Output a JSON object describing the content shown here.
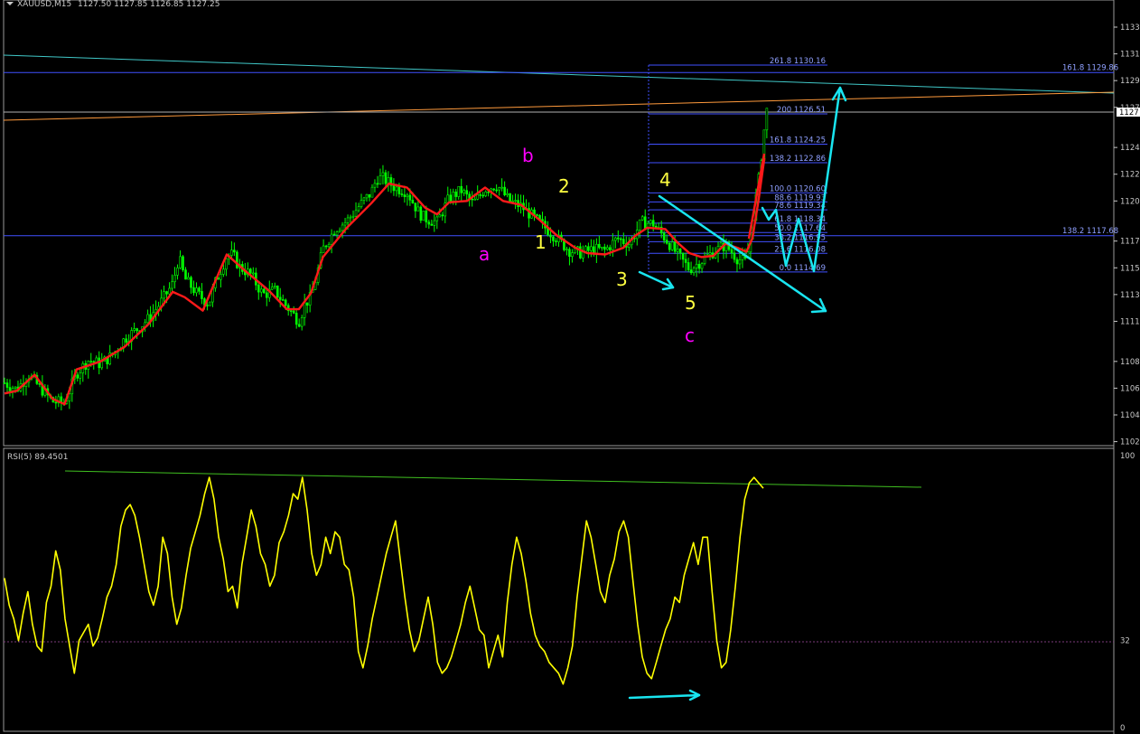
{
  "header": {
    "symbol": "XAUUSD,M15",
    "ohlc": "1127.50 1127.85 1126.85 1127.25",
    "rsi_label": "RSI(5) 89.4501"
  },
  "price_axis": {
    "ticks": [
      "1133",
      "1131",
      "1129",
      "1127",
      "1124",
      "1122",
      "1120",
      "1117",
      "1115",
      "1113",
      "1111",
      "1108",
      "1106",
      "1104",
      "1102"
    ],
    "current_price": "1127"
  },
  "rsi_axis": {
    "ticks": [
      "100",
      "32",
      "0"
    ]
  },
  "fib_levels": [
    {
      "label": "261.8 1130.16",
      "price": 1130.16
    },
    {
      "label": "200 1126.51",
      "price": 1126.51
    },
    {
      "label": "161.8 1124.25",
      "price": 1124.25
    },
    {
      "label": "138.2 1122.86",
      "price": 1122.86
    },
    {
      "label": "100.0 1120.60",
      "price": 1120.6
    },
    {
      "label": "88.6 1119.93",
      "price": 1119.93
    },
    {
      "label": "78.6 1119.34",
      "price": 1119.34
    },
    {
      "label": "61.8 1118.34",
      "price": 1118.34
    },
    {
      "label": "50.0 1117.64",
      "price": 1117.64
    },
    {
      "label": "38.2 1116.95",
      "price": 1116.95
    },
    {
      "label": "23.6 1116.08",
      "price": 1116.08
    },
    {
      "label": "0.0 1114.69",
      "price": 1114.69
    }
  ],
  "long_fib_levels": [
    {
      "label": "161.8 1129.86",
      "price": 1129.6
    },
    {
      "label": "138.2 1117.68",
      "price": 1117.4
    }
  ],
  "wave_labels": [
    {
      "text": "b",
      "color": "#ff00ff"
    },
    {
      "text": "a",
      "color": "#ff00ff"
    },
    {
      "text": "c",
      "color": "#ff00ff"
    },
    {
      "text": "2",
      "color": "#ffff40"
    },
    {
      "text": "1",
      "color": "#ffff40"
    },
    {
      "text": "3",
      "color": "#ffff40"
    },
    {
      "text": "4",
      "color": "#ffff40"
    },
    {
      "text": "5",
      "color": "#ffff40"
    }
  ],
  "colors": {
    "candle": "#00ff00",
    "moving_average": "#ff1a1a",
    "rsi_line": "#ffff00",
    "arrows": "#19e5f0",
    "fib_lines": "#4050ff",
    "trendline_upper": "#40c8c8",
    "trendline_orange": "#ff9a3c",
    "rsi_trendline": "#40c020"
  },
  "chart_data": [
    {
      "type": "line",
      "title": "XAUUSD,M15",
      "ylim": [
        1101.8,
        1135
      ],
      "grid": false,
      "ma_path": [
        [
          0.0,
          1105.6
        ],
        [
          0.02,
          1105.8
        ],
        [
          0.05,
          1107.0
        ],
        [
          0.08,
          1105.2
        ],
        [
          0.1,
          1104.8
        ],
        [
          0.12,
          1107.4
        ],
        [
          0.16,
          1108.0
        ],
        [
          0.2,
          1109.1
        ],
        [
          0.24,
          1110.8
        ],
        [
          0.28,
          1113.2
        ],
        [
          0.3,
          1112.8
        ],
        [
          0.33,
          1111.8
        ],
        [
          0.35,
          1113.9
        ],
        [
          0.37,
          1116.0
        ],
        [
          0.4,
          1114.8
        ],
        [
          0.44,
          1113.3
        ],
        [
          0.47,
          1111.9
        ],
        [
          0.49,
          1111.9
        ],
        [
          0.51,
          1113.1
        ],
        [
          0.53,
          1115.8
        ],
        [
          0.57,
          1118.0
        ],
        [
          0.61,
          1119.8
        ],
        [
          0.64,
          1121.3
        ],
        [
          0.67,
          1121.0
        ],
        [
          0.7,
          1119.5
        ],
        [
          0.72,
          1119.0
        ],
        [
          0.74,
          1119.9
        ],
        [
          0.77,
          1120.0
        ],
        [
          0.8,
          1121.0
        ],
        [
          0.83,
          1120.0
        ],
        [
          0.86,
          1119.7
        ],
        [
          0.89,
          1118.6
        ],
        [
          0.92,
          1117.4
        ],
        [
          0.95,
          1116.5
        ],
        [
          0.97,
          1116.1
        ],
        [
          1.0,
          1116.0
        ],
        [
          1.03,
          1116.5
        ],
        [
          1.05,
          1117.4
        ],
        [
          1.07,
          1118.0
        ],
        [
          1.1,
          1117.9
        ],
        [
          1.12,
          1116.9
        ],
        [
          1.14,
          1116.1
        ],
        [
          1.16,
          1115.8
        ],
        [
          1.18,
          1115.9
        ],
        [
          1.2,
          1116.8
        ],
        [
          1.22,
          1116.5
        ],
        [
          1.235,
          1116.2
        ],
        [
          1.245,
          1117.2
        ],
        [
          1.255,
          1120.0
        ],
        [
          1.265,
          1123.2
        ]
      ],
      "price_path": [
        [
          0.0,
          1106.4
        ],
        [
          0.02,
          1105.9
        ],
        [
          0.04,
          1107.0
        ],
        [
          0.06,
          1106.0
        ],
        [
          0.08,
          1105.0
        ],
        [
          0.1,
          1104.9
        ],
        [
          0.12,
          1107.1
        ],
        [
          0.14,
          1108.1
        ],
        [
          0.16,
          1107.8
        ],
        [
          0.18,
          1108.5
        ],
        [
          0.2,
          1109.7
        ],
        [
          0.22,
          1110.4
        ],
        [
          0.24,
          1111.2
        ],
        [
          0.26,
          1112.4
        ],
        [
          0.28,
          1113.8
        ],
        [
          0.29,
          1115.8
        ],
        [
          0.3,
          1114.2
        ],
        [
          0.32,
          1113.1
        ],
        [
          0.34,
          1112.3
        ],
        [
          0.35,
          1113.8
        ],
        [
          0.37,
          1115.9
        ],
        [
          0.38,
          1116.0
        ],
        [
          0.39,
          1115.1
        ],
        [
          0.41,
          1114.5
        ],
        [
          0.43,
          1113.0
        ],
        [
          0.45,
          1113.3
        ],
        [
          0.47,
          1112.1
        ],
        [
          0.49,
          1111.0
        ],
        [
          0.5,
          1112.3
        ],
        [
          0.51,
          1112.8
        ],
        [
          0.52,
          1114.5
        ],
        [
          0.53,
          1116.4
        ],
        [
          0.55,
          1117.9
        ],
        [
          0.57,
          1118.5
        ],
        [
          0.59,
          1119.6
        ],
        [
          0.61,
          1120.6
        ],
        [
          0.62,
          1121.7
        ],
        [
          0.63,
          1121.7
        ],
        [
          0.65,
          1121.0
        ],
        [
          0.67,
          1120.7
        ],
        [
          0.69,
          1119.1
        ],
        [
          0.7,
          1118.7
        ],
        [
          0.72,
          1118.4
        ],
        [
          0.74,
          1120.2
        ],
        [
          0.76,
          1120.8
        ],
        [
          0.78,
          1119.8
        ],
        [
          0.8,
          1120.9
        ],
        [
          0.82,
          1121.2
        ],
        [
          0.84,
          1120.0
        ],
        [
          0.86,
          1119.6
        ],
        [
          0.88,
          1118.8
        ],
        [
          0.9,
          1118.0
        ],
        [
          0.92,
          1117.2
        ],
        [
          0.94,
          1116.3
        ],
        [
          0.96,
          1116.1
        ],
        [
          0.98,
          1116.4
        ],
        [
          1.0,
          1116.3
        ],
        [
          1.02,
          1117.2
        ],
        [
          1.04,
          1116.8
        ],
        [
          1.06,
          1118.4
        ],
        [
          1.08,
          1118.3
        ],
        [
          1.1,
          1117.2
        ],
        [
          1.12,
          1116.0
        ],
        [
          1.14,
          1114.9
        ],
        [
          1.16,
          1115.5
        ],
        [
          1.18,
          1116.2
        ],
        [
          1.2,
          1116.7
        ],
        [
          1.22,
          1115.7
        ],
        [
          1.235,
          1115.4
        ],
        [
          1.245,
          1118.5
        ],
        [
          1.255,
          1121.4
        ],
        [
          1.262,
          1124.2
        ],
        [
          1.267,
          1126.4
        ],
        [
          1.272,
          1127.3
        ]
      ]
    },
    {
      "type": "line",
      "title": "RSI(5) 89.4501",
      "ylim": [
        0,
        100
      ],
      "levels": [
        32
      ],
      "series": [
        {
          "values": [
            55,
            45,
            40,
            32,
            42,
            50,
            38,
            30,
            28,
            46,
            52,
            65,
            58,
            40,
            30,
            20,
            32,
            35,
            38,
            30,
            33,
            40,
            48,
            52,
            60,
            74,
            80,
            82,
            78,
            70,
            60,
            50,
            45,
            52,
            70,
            64,
            48,
            38,
            44,
            56,
            66,
            72,
            78,
            86,
            92,
            84,
            70,
            62,
            50,
            52,
            44,
            60,
            70,
            80,
            74,
            64,
            60,
            52,
            56,
            68,
            72,
            78,
            86,
            84,
            92,
            80,
            64,
            56,
            60,
            70,
            64,
            72,
            70,
            60,
            58,
            48,
            28,
            22,
            30,
            40,
            48,
            56,
            64,
            70,
            76,
            62,
            48,
            36,
            28,
            32,
            40,
            48,
            38,
            24,
            20,
            22,
            26,
            32,
            38,
            46,
            52,
            44,
            36,
            34,
            22,
            28,
            34,
            26,
            46,
            60,
            70,
            64,
            54,
            42,
            34,
            30,
            28,
            24,
            22,
            20,
            16,
            22,
            30,
            48,
            62,
            76,
            70,
            60,
            50,
            46,
            56,
            62,
            72,
            76,
            70,
            54,
            38,
            26,
            20,
            18,
            24,
            30,
            36,
            40,
            48,
            46,
            56,
            62,
            68,
            60,
            70,
            70,
            50,
            32,
            22,
            24,
            36,
            52,
            70,
            84,
            90,
            92,
            90,
            88
          ]
        }
      ]
    }
  ]
}
